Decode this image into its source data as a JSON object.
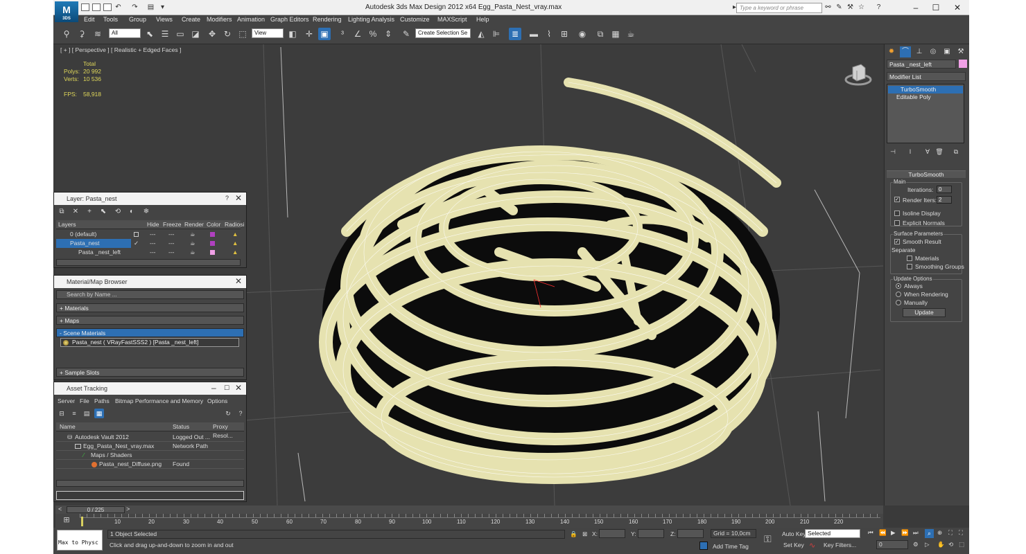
{
  "app": {
    "title": "Autodesk 3ds Max Design 2012 x64     Egg_Pasta_Nest_vray.max",
    "logo_text": "3DS"
  },
  "search": {
    "placeholder": "Type a keyword or phrase"
  },
  "menu": [
    "Edit",
    "Tools",
    "Group",
    "Views",
    "Create",
    "Modifiers",
    "Animation",
    "Graph Editors",
    "Rendering",
    "Lighting Analysis",
    "Customize",
    "MAXScript",
    "Help"
  ],
  "toolbar": {
    "selection_filter": "All",
    "ref_coord": "View",
    "named_selection": "Create Selection Se"
  },
  "viewport": {
    "label": "[ + ] [ Perspective ] [ Realistic + Edged Faces ]",
    "stats": {
      "total_label": "Total",
      "polys_label": "Polys:",
      "polys_value": "20 992",
      "verts_label": "Verts:",
      "verts_value": "10 536",
      "fps_label": "FPS:",
      "fps_value": "58,918"
    },
    "mesh_color": "#e6e2b0",
    "wire_color": "#ffffff"
  },
  "command_panel": {
    "object_name": "Pasta _nest_left",
    "object_color": "#f0a0e6",
    "modifier_list": "Modifier List",
    "stack": [
      "TurboSmooth",
      "Editable Poly"
    ],
    "rollout_title": "TurboSmooth",
    "main_group": "Main",
    "iterations_label": "Iterations:",
    "iterations_value": "0",
    "render_iters_label": "Render Iters:",
    "render_iters_value": "2",
    "isoline": "Isoline Display",
    "explicit_normals": "Explicit Normals",
    "surface_group": "Surface Parameters",
    "smooth_result": "Smooth Result",
    "separate": "Separate",
    "materials": "Materials",
    "smoothing_groups": "Smoothing Groups",
    "update_group": "Update Options",
    "always": "Always",
    "when_rendering": "When Rendering",
    "manually": "Manually",
    "update_btn": "Update"
  },
  "layer_panel": {
    "title": "Layer: Pasta_nest",
    "columns": [
      "Layers",
      "Hide",
      "Freeze",
      "Render",
      "Color",
      "Radiosi"
    ],
    "rows": [
      {
        "name": "0 (default)",
        "color": "#b040c0"
      },
      {
        "name": "Pasta_nest",
        "color": "#b040c0"
      },
      {
        "name": "Pasta _nest_left",
        "color": "#f0a0e6"
      }
    ]
  },
  "material_browser": {
    "title": "Material/Map Browser",
    "search_placeholder": "Search by Name ...",
    "sections": [
      "+ Materials",
      "+ Maps",
      "- Scene Materials",
      "+ Sample Slots"
    ],
    "scene_material": "Pasta_nest  ( VRayFastSSS2 )  [Pasta _nest_left]"
  },
  "asset_tracking": {
    "title": "Asset Tracking",
    "menu": [
      "Server",
      "File",
      "Paths",
      "Bitmap Performance and Memory",
      "Options"
    ],
    "columns": [
      "Name",
      "Status",
      "Proxy Resol..."
    ],
    "rows": [
      {
        "name": "Autodesk Vault 2012",
        "status": "Logged Out ..."
      },
      {
        "name": "Egg_Pasta_Nest_vray.max",
        "status": "Network Path"
      },
      {
        "name": "Maps / Shaders",
        "status": ""
      },
      {
        "name": "Pasta_nest_Diffuse.png",
        "status": "Found"
      }
    ]
  },
  "timeline": {
    "frame": "0 / 225",
    "ticks": [
      "10",
      "20",
      "30",
      "40",
      "50",
      "60",
      "70",
      "80",
      "90",
      "100",
      "110",
      "120",
      "130",
      "140",
      "150",
      "160",
      "170",
      "180",
      "190",
      "200",
      "210",
      "220"
    ]
  },
  "status": {
    "script_listener": "Max to Physc",
    "selected": "1 Object Selected",
    "prompt": "Click and drag up-and-down to zoom in and out",
    "x_label": "X:",
    "y_label": "Y:",
    "z_label": "Z:",
    "grid": "Grid = 10,0cm",
    "add_time_tag": "Add Time Tag",
    "auto_key": "Auto Key",
    "set_key": "Set Key",
    "key_mode": "Selected",
    "key_filters": "Key Filters...",
    "current_frame": "0"
  }
}
